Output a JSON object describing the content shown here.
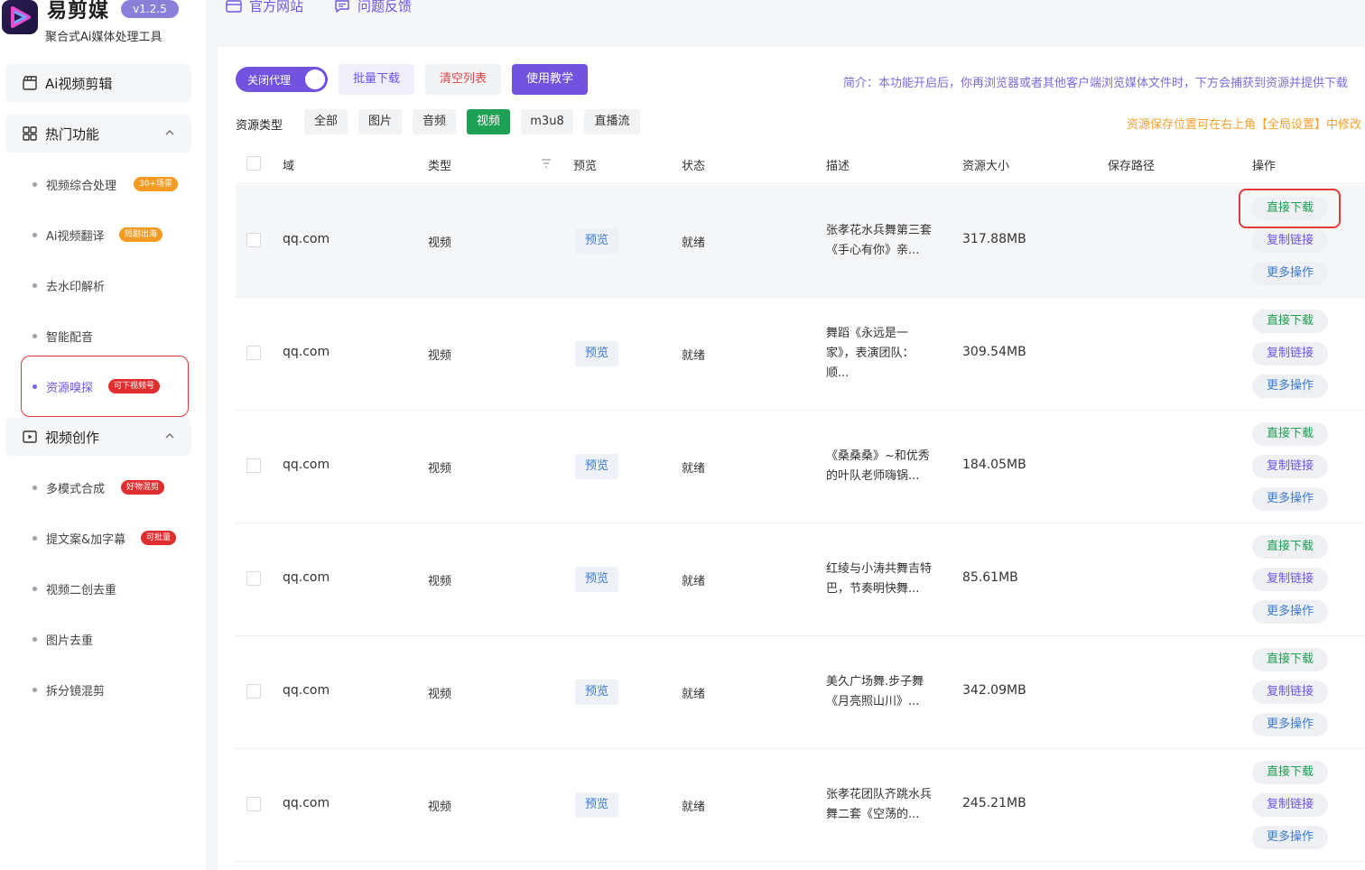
{
  "app": {
    "name": "易剪媒",
    "version": "v1.2.5",
    "tagline": "聚合式Ai媒体处理工具"
  },
  "topbar": {
    "official_site": "官方网站",
    "feedback": "问题反馈"
  },
  "sidebar": {
    "video_edit": "Ai视频剪辑",
    "hot_features": {
      "label": "热门功能",
      "items": [
        {
          "label": "视频综合处理",
          "tag": "30+场景",
          "tag_color": "orange"
        },
        {
          "label": "Ai视频翻译",
          "tag": "短剧出海",
          "tag_color": "orange"
        },
        {
          "label": "去水印解析"
        },
        {
          "label": "智能配音"
        },
        {
          "label": "资源嗅探",
          "tag": "可下视频号",
          "tag_color": "red",
          "active": true
        }
      ]
    },
    "video_create": {
      "label": "视频创作",
      "items": [
        {
          "label": "多模式合成",
          "tag": "好物混剪",
          "tag_color": "red"
        },
        {
          "label": "提文案&加字幕",
          "tag": "可批量",
          "tag_color": "red"
        },
        {
          "label": "视频二创去重"
        },
        {
          "label": "图片去重"
        },
        {
          "label": "拆分镜混剪"
        }
      ]
    }
  },
  "toolbar": {
    "proxy_toggle": "关闭代理",
    "batch_download": "批量下载",
    "clear_list": "清空列表",
    "tutorial": "使用教学",
    "intro": "简介：本功能开启后，你再浏览器或者其他客户端浏览媒体文件时，下方会捕获到资源并提供下载"
  },
  "filters": {
    "label": "资源类型",
    "options": [
      "全部",
      "图片",
      "音频",
      "视频",
      "m3u8",
      "直播流"
    ],
    "active": "视频",
    "save_note": "资源保存位置可在右上角【全局设置】中修改"
  },
  "table": {
    "headers": {
      "domain": "域",
      "type": "类型",
      "preview": "预览",
      "status": "状态",
      "desc": "描述",
      "size": "资源大小",
      "path": "保存路径",
      "ops": "操作"
    },
    "preview_label": "预览",
    "actions": {
      "download": "直接下载",
      "copy": "复制链接",
      "more": "更多操作"
    },
    "rows": [
      {
        "domain": "qq.com",
        "type": "视频",
        "status": "就绪",
        "desc_l1": "张孝花水兵舞第三套",
        "desc_l2": "《手心有你》亲...",
        "desc_l3": "",
        "size": "317.88MB"
      },
      {
        "domain": "qq.com",
        "type": "视频",
        "status": "就绪",
        "desc_l1": "舞蹈《永远是一",
        "desc_l2": "家》，表演团队：",
        "desc_l3": "顺...",
        "size": "309.54MB"
      },
      {
        "domain": "qq.com",
        "type": "视频",
        "status": "就绪",
        "desc_l1": "《桑桑桑》~和优秀",
        "desc_l2": "的叶队老师嗨锅...",
        "desc_l3": "",
        "size": "184.05MB"
      },
      {
        "domain": "qq.com",
        "type": "视频",
        "status": "就绪",
        "desc_l1": "红绫与小涛共舞吉特",
        "desc_l2": "巴，节奏明快舞...",
        "desc_l3": "",
        "size": "85.61MB"
      },
      {
        "domain": "qq.com",
        "type": "视频",
        "status": "就绪",
        "desc_l1": "美久广场舞.步子舞",
        "desc_l2": "《月亮照山川》...",
        "desc_l3": "",
        "size": "342.09MB"
      },
      {
        "domain": "qq.com",
        "type": "视频",
        "status": "就绪",
        "desc_l1": "张孝花团队齐跳水兵",
        "desc_l2": "舞二套《空荡的...",
        "desc_l3": "",
        "size": "245.21MB"
      }
    ]
  }
}
